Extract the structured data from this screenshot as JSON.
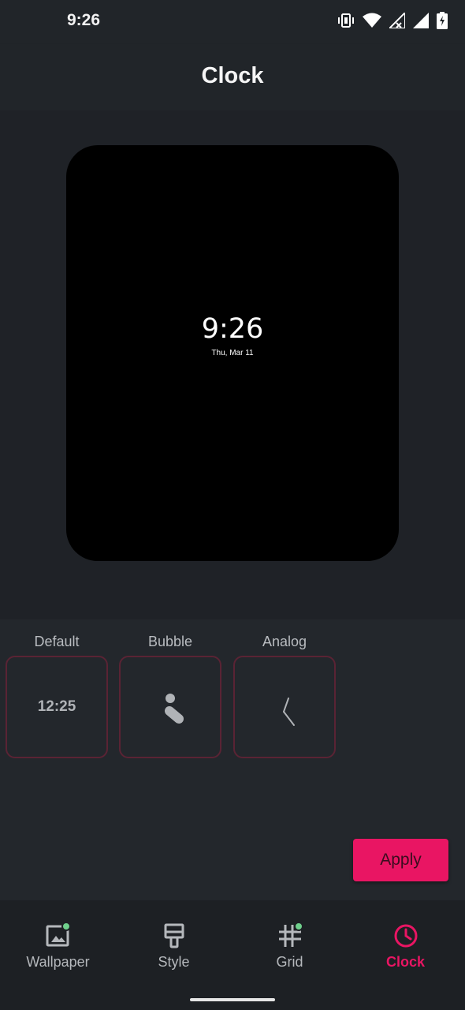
{
  "status_bar": {
    "time": "9:26"
  },
  "header": {
    "title": "Clock"
  },
  "preview": {
    "time": "9:26",
    "date": "Thu, Mar 11"
  },
  "clock_options": [
    {
      "label": "Default",
      "tile_text": "12:25"
    },
    {
      "label": "Bubble"
    },
    {
      "label": "Analog"
    }
  ],
  "apply_label": "Apply",
  "nav": {
    "items": [
      {
        "label": "Wallpaper",
        "icon": "wallpaper-icon"
      },
      {
        "label": "Style",
        "icon": "brush-icon"
      },
      {
        "label": "Grid",
        "icon": "grid-icon"
      },
      {
        "label": "Clock",
        "icon": "clock-icon"
      }
    ],
    "active": "Clock"
  },
  "colors": {
    "accent": "#e91563",
    "badge": "#6fd08c",
    "tile_border": "#5a2334"
  }
}
